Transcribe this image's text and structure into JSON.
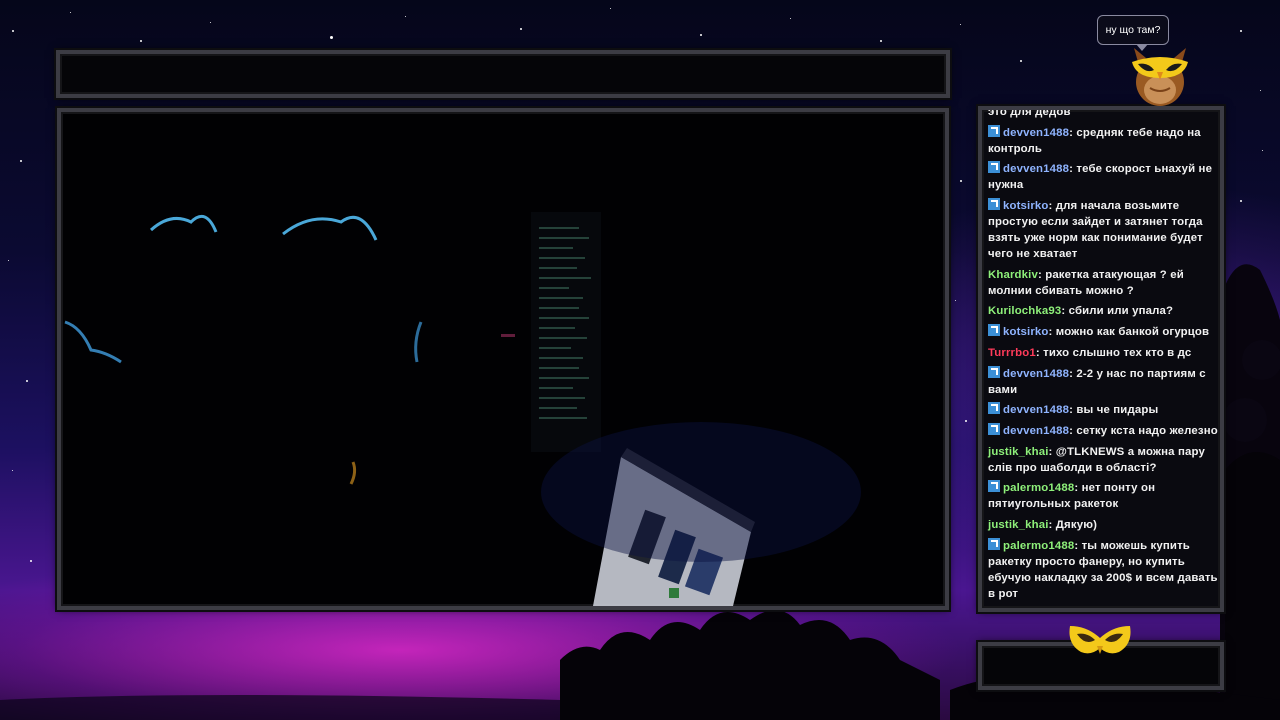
{
  "overlay": {
    "speech_bubble": "ну що там?",
    "title_bar_text": "",
    "bottom_box_text": ""
  },
  "colors": {
    "badge": "#3b8fd6",
    "user_blue": "#8fb4ff",
    "user_green": "#8ef07a",
    "user_red": "#ff3b5a",
    "frame_border": "#3c3c44",
    "owl_gold": "#f3c91a"
  },
  "icons": {
    "owl_mascot": "owl-icon",
    "mask_logo": "owl-mask-icon",
    "badge": "verified-badge-icon"
  },
  "chat": {
    "messages": [
      {
        "user": "",
        "text": "это для дедов",
        "badge": false,
        "color": "blue"
      },
      {
        "user": "devven1488",
        "text": "средняк тебе надо на контроль",
        "badge": true,
        "color": "blue"
      },
      {
        "user": "devven1488",
        "text": "тебе скорост ьнахуй не нужна",
        "badge": true,
        "color": "blue"
      },
      {
        "user": "kotsirko",
        "text": "для начала возьмите простую если зайдет и затянет тогда взять уже норм как понимание будет чего не хватает",
        "badge": true,
        "color": "blue"
      },
      {
        "user": "Khardkiv",
        "text": "ракетка атакующая ? ей молнии сбивать можно ?",
        "badge": false,
        "color": "green"
      },
      {
        "user": "Kurilochka93",
        "text": "сбили или упала?",
        "badge": false,
        "color": "green"
      },
      {
        "user": "kotsirko",
        "text": "можно как банкой огурцов",
        "badge": true,
        "color": "blue"
      },
      {
        "user": "Turrrbo1",
        "text": "тихо слышно тех кто в дс",
        "badge": false,
        "color": "red"
      },
      {
        "user": "devven1488",
        "text": "2-2 у нас по партиям с вами",
        "badge": true,
        "color": "blue"
      },
      {
        "user": "devven1488",
        "text": "вы че пидары",
        "badge": true,
        "color": "blue"
      },
      {
        "user": "devven1488",
        "text": "сетку кста надо железно",
        "badge": true,
        "color": "blue"
      },
      {
        "user": "justik_khai",
        "text": "@TLKNEWS а можна пару слів про шаболди в області?",
        "badge": false,
        "color": "green"
      },
      {
        "user": "palermo1488",
        "text": "нет понту он пятиугольных ракеток",
        "badge": true,
        "color": "green"
      },
      {
        "user": "justik_khai",
        "text": "Дякую)",
        "badge": false,
        "color": "green"
      },
      {
        "user": "palermo1488",
        "text": "ты можешь купить ракетку просто фанеру, но купить ебучую накладку за 200$ и всем давать в рот",
        "badge": true,
        "color": "green"
      }
    ]
  }
}
